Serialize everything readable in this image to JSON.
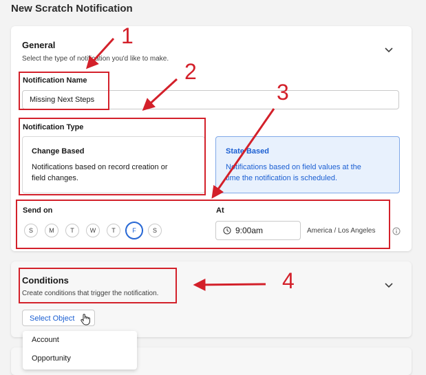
{
  "page": {
    "title": "New Scratch Notification"
  },
  "general": {
    "title": "General",
    "description": "Select the type of notification you'd like to make.",
    "name_label": "Notification Name",
    "name_value": "Missing Next Steps",
    "type_label": "Notification Type",
    "types": [
      {
        "title": "Change Based",
        "description_line1": "Notifications based on record creation or",
        "description_line2": "field changes.",
        "selected": false
      },
      {
        "title": "State Based",
        "description_line1": "Notifications based on field values at the",
        "description_line2": "time the notification is scheduled.",
        "selected": true
      }
    ],
    "send_on_label": "Send on",
    "days": [
      {
        "label": "S",
        "selected": false
      },
      {
        "label": "M",
        "selected": false
      },
      {
        "label": "T",
        "selected": false
      },
      {
        "label": "W",
        "selected": false
      },
      {
        "label": "T",
        "selected": false
      },
      {
        "label": "F",
        "selected": true
      },
      {
        "label": "S",
        "selected": false
      }
    ],
    "at_label": "At",
    "time_value": "9:00am",
    "timezone": "America / Los Angeles"
  },
  "conditions": {
    "title": "Conditions",
    "description": "Create conditions that trigger the notification.",
    "select_button": "Select Object",
    "dropdown_options": [
      "Account",
      "Opportunity"
    ]
  },
  "annotations": [
    "1",
    "2",
    "3",
    "4"
  ],
  "colors": {
    "accent": "#1b5fd2",
    "annotation": "#d3202a",
    "selected_bg": "#e8f1fd"
  }
}
